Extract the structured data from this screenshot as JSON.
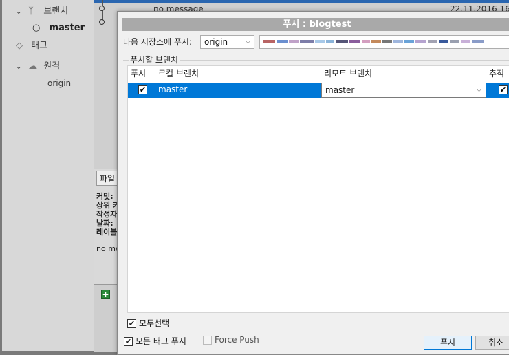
{
  "sidebar": {
    "branches_label": "브랜치",
    "current_branch": "master",
    "tags_label": "태그",
    "remotes_label": "원격",
    "remote_origin": "origin"
  },
  "history": {
    "commit_message": "no message",
    "commit_date": "22.11.2016 16"
  },
  "detail": {
    "file_tab": "파일",
    "labels": [
      "커밋:",
      "상위 커",
      "작성자:",
      "날짜:",
      "레이블"
    ],
    "message": "no message"
  },
  "dialog": {
    "title": "푸시 : blogtest",
    "push_to_label": "다음 저장소에 푸시:",
    "remote_selected": "origin",
    "group_label": "푸시할 브랜치",
    "columns": {
      "push": "푸시",
      "local": "로컬 브랜치",
      "remote": "리모트 브랜치",
      "track": "추적"
    },
    "row": {
      "push_checked": true,
      "local": "master",
      "remote": "master",
      "track_checked": true
    },
    "select_all": "모두선택",
    "push_all_tags": "모든 태그 푸시",
    "force_push": "Force Push",
    "push_button": "푸시",
    "cancel_button": "취소"
  }
}
